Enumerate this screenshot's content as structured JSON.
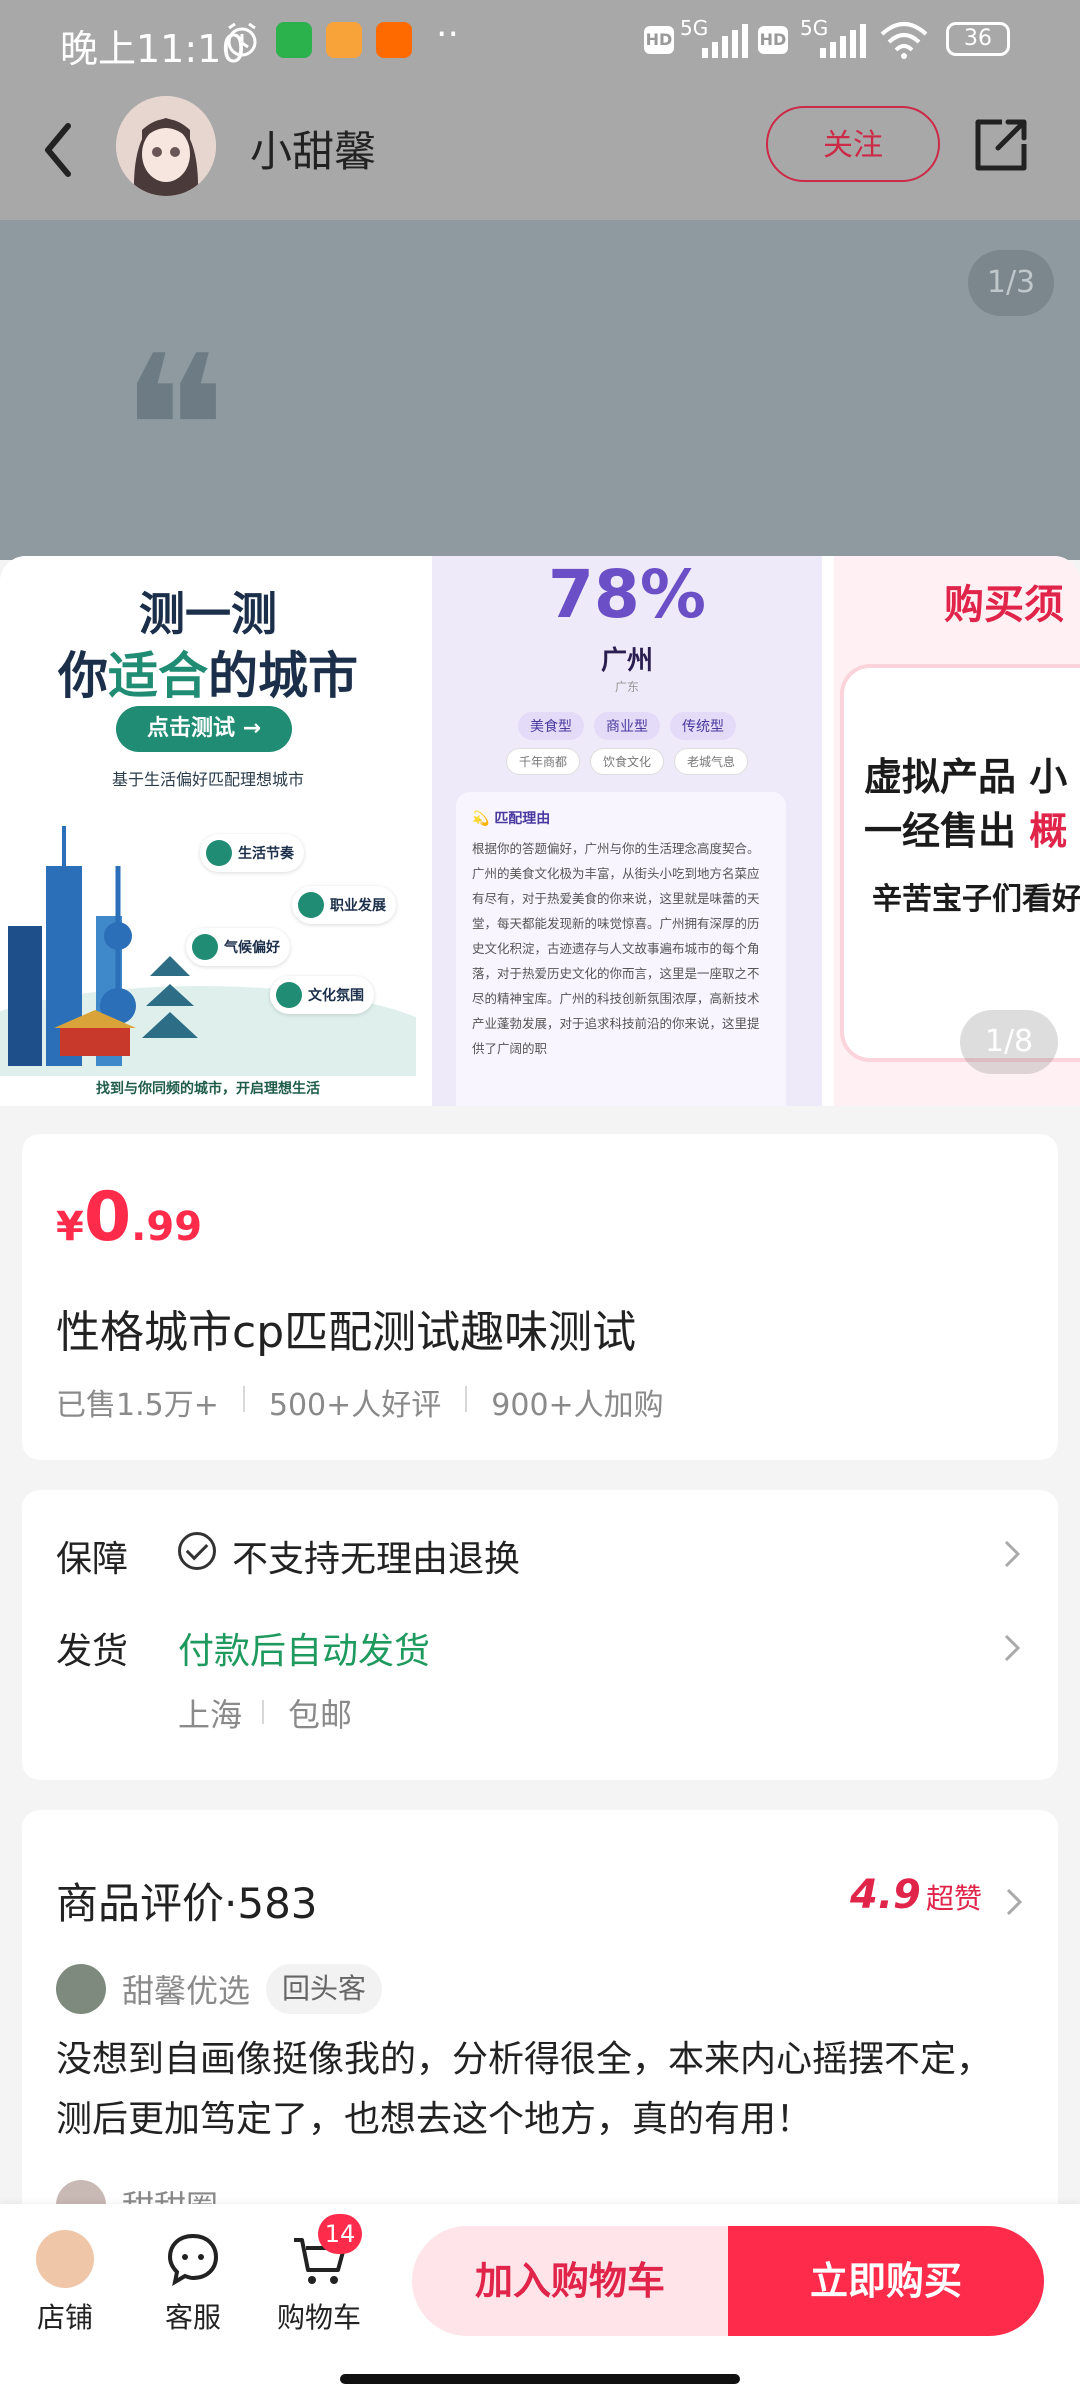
{
  "status_bar": {
    "time": "晚上11:10",
    "net1": "5G",
    "net2": "5G",
    "hd": "HD",
    "battery": "36"
  },
  "header": {
    "shop_name": "小甜馨",
    "follow_label": "关注"
  },
  "top_overlay": {
    "page_indicator": "1/3"
  },
  "carousel": {
    "counter": "1/8",
    "slide1": {
      "title_line1": "测一测",
      "title_pre": "你",
      "title_highlight": "适合",
      "title_post": "的城市",
      "cta": "点击测试 →",
      "subtitle": "基于生活偏好匹配理想城市",
      "tags": [
        {
          "label": "生活节奏"
        },
        {
          "label": "职业发展"
        },
        {
          "label": "气候偏好"
        },
        {
          "label": "文化氛围"
        }
      ],
      "footer": "找到与你同频的城市，开启理想生活"
    },
    "slide2": {
      "percent": "78%",
      "city": "广州",
      "province": "广东",
      "tags_row1": [
        "美食型",
        "商业型",
        "传统型"
      ],
      "tags_row2": [
        "千年商都",
        "饮食文化",
        "老城气息"
      ],
      "card_heading": "匹配理由",
      "card_body": "根据你的答题偏好，广州与你的生活理念高度契合。广州的美食文化极为丰富，从街头小吃到地方名菜应有尽有，对于热爱美食的你来说，这里就是味蕾的天堂，每天都能发现新的味觉惊喜。广州拥有深厚的历史文化积淀，古迹遗存与人文故事遍布城市的每个角落，对于热爱历史文化的你而言，这里是一座取之不尽的精神宝库。广州的科技创新氛围浓厚，高新技术产业蓬勃发展，对于追求科技前沿的你来说，这里提供了广阔的职"
    },
    "slide3": {
      "title": "购买须",
      "line1_pre": "虚拟产品 小",
      "line2_pre": "一经售出 ",
      "line2_highlight": "概",
      "line3": "辛苦宝子们看好"
    }
  },
  "product": {
    "currency": "¥",
    "price_int": "0",
    "price_dec": ".99",
    "title": "性格城市cp匹配测试趣味测试",
    "sold": "已售1.5万+",
    "good_reviews": "500+人好评",
    "added": "900+人加购"
  },
  "service": {
    "guarantee_label": "保障",
    "guarantee_value": "不支持无理由退换",
    "shipping_label": "发货",
    "shipping_value": "付款后自动发货",
    "origin": "上海",
    "postage": "包邮"
  },
  "reviews": {
    "title": "商品评价·583",
    "score": "4.9",
    "score_label": "超赞",
    "items": [
      {
        "name": "甜馨优选",
        "badge": "回头客",
        "text": "没想到自画像挺像我的，分析得很全，本来内心摇摆不定，测后更加笃定了，也想去这个地方，真的有用！"
      },
      {
        "name": "甜甜圈"
      }
    ]
  },
  "bottom_bar": {
    "shop": "店铺",
    "service": "客服",
    "cart": "购物车",
    "cart_count": "14",
    "add_to_cart": "加入购物车",
    "buy_now": "立即购买"
  },
  "colors": {
    "accent": "#ff2b4b",
    "green": "#1f9a5e"
  }
}
